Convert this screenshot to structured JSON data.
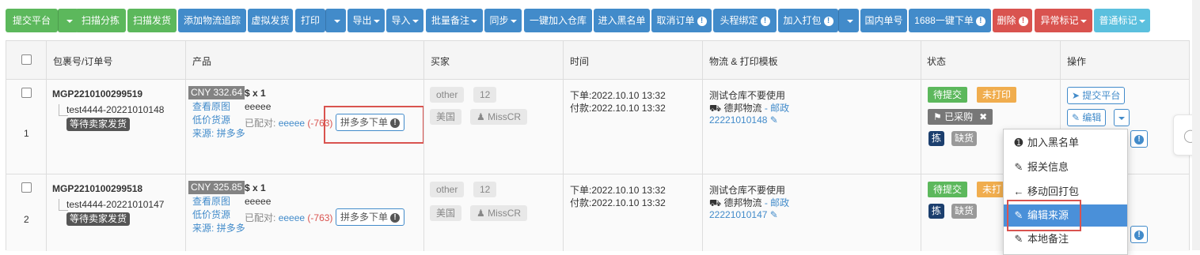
{
  "toolbar": {
    "submit_platform": "提交平台",
    "scan_sort": "扫描分拣",
    "scan_ship": "扫描发货",
    "add_tracking": "添加物流追踪",
    "virtual_ship": "虚拟发货",
    "print": "打印",
    "export": "导出",
    "import": "导入",
    "batch_remark": "批量备注",
    "sync": "同步",
    "add_warehouse": "一键加入仓库",
    "blacklist": "进入黑名单",
    "cancel_order": "取消订单",
    "head_bind": "头程绑定",
    "add_pack": "加入打包",
    "domestic_no": "国内单号",
    "order_1688": "1688一键下单",
    "delete": "删除",
    "abnormal_mark": "异常标记",
    "normal_mark": "普通标记"
  },
  "table": {
    "headers": {
      "package": "包裹号/订单号",
      "product": "产品",
      "buyer": "买家",
      "time": "时间",
      "logistics": "物流 & 打印模板",
      "status": "状态",
      "action": "操作"
    },
    "rows": [
      {
        "index": "1",
        "package_no": "MGP2210100299519",
        "order_no": "test4444-20221010148",
        "wait_tag": "等待卖家发货",
        "price": "CNY 332.64",
        "qty": "$ x 1",
        "sku": "eeeee",
        "view_image": "查看原图",
        "low_price": "低价货源",
        "matched_label": "已配对:",
        "matched_value": "eeeee",
        "matched_diff": "(-763)",
        "source_label": "来源:",
        "source_value": "拼多多",
        "pdd_button": "拼多多下单",
        "buyer_platform": "other",
        "buyer_count": "12",
        "buyer_country": "美国",
        "buyer_name": "MissCR",
        "order_time": "下单:2022.10.10 13:32",
        "pay_time": "付款:2022.10.10 13:32",
        "warehouse": "测试仓库不要使用",
        "carrier": "德邦物流",
        "carrier_sep": "-",
        "carrier_type": "邮政",
        "tracking": "22221010148",
        "status_1": "待提交",
        "status_2": "未打印",
        "purchased": "已采购",
        "pick": "拣",
        "shortage": "缺货",
        "action_submit": "提交平台",
        "action_edit": "编辑"
      },
      {
        "index": "2",
        "package_no": "MGP2210100299518",
        "order_no": "test4444-20221010147",
        "wait_tag": "等待卖家发货",
        "price": "CNY 325.85",
        "qty": "$ x 1",
        "sku": "eeeee",
        "view_image": "查看原图",
        "low_price": "低价货源",
        "matched_label": "已配对:",
        "matched_value": "eeeee",
        "matched_diff": "(-763)",
        "source_label": "来源:",
        "source_value": "拼多多",
        "pdd_button": "拼多多下单",
        "buyer_platform": "other",
        "buyer_count": "12",
        "buyer_country": "美国",
        "buyer_name": "MissCR",
        "order_time": "下单:2022.10.10 13:32",
        "pay_time": "付款:2022.10.10 13:32",
        "warehouse": "测试仓库不要使用",
        "carrier": "德邦物流",
        "carrier_sep": "-",
        "carrier_type": "邮政",
        "tracking": "22221010147",
        "status_1": "待提交",
        "status_2": "未打",
        "pick": "拣",
        "shortage": "缺货"
      }
    ]
  },
  "dropdown": {
    "items": [
      {
        "icon": "info-icon",
        "label": "加入黑名单"
      },
      {
        "icon": "edit-icon",
        "label": "报关信息"
      },
      {
        "icon": "arrow-left-icon",
        "label": "移动回打包"
      },
      {
        "icon": "edit-icon",
        "label": "编辑来源"
      },
      {
        "icon": "edit-icon",
        "label": "本地备注"
      }
    ]
  }
}
